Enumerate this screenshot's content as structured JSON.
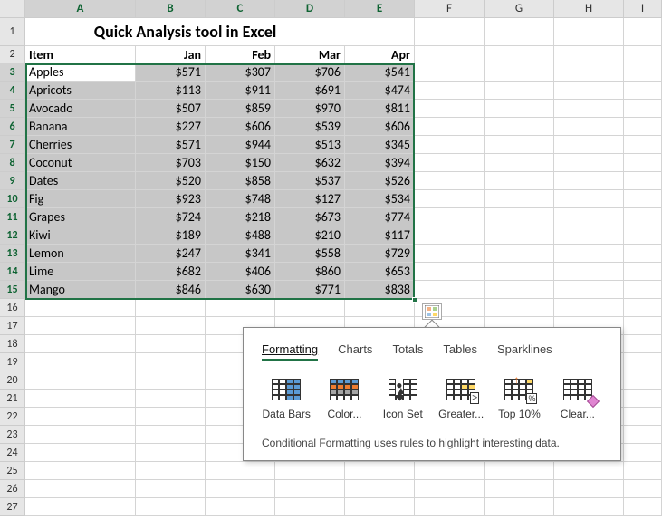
{
  "columns": [
    "A",
    "B",
    "C",
    "D",
    "E",
    "F",
    "G",
    "H",
    "I"
  ],
  "title": "Quick Analysis tool in Excel",
  "headers": [
    "Item",
    "Jan",
    "Feb",
    "Mar",
    "Apr"
  ],
  "rows": [
    {
      "item": "Apples",
      "vals": [
        "$571",
        "$307",
        "$706",
        "$541"
      ]
    },
    {
      "item": "Apricots",
      "vals": [
        "$113",
        "$911",
        "$691",
        "$474"
      ]
    },
    {
      "item": "Avocado",
      "vals": [
        "$507",
        "$859",
        "$970",
        "$811"
      ]
    },
    {
      "item": "Banana",
      "vals": [
        "$227",
        "$606",
        "$539",
        "$606"
      ]
    },
    {
      "item": "Cherries",
      "vals": [
        "$571",
        "$944",
        "$513",
        "$345"
      ]
    },
    {
      "item": "Coconut",
      "vals": [
        "$703",
        "$150",
        "$632",
        "$394"
      ]
    },
    {
      "item": "Dates",
      "vals": [
        "$520",
        "$858",
        "$537",
        "$526"
      ]
    },
    {
      "item": "Fig",
      "vals": [
        "$923",
        "$748",
        "$127",
        "$534"
      ]
    },
    {
      "item": "Grapes",
      "vals": [
        "$724",
        "$218",
        "$673",
        "$774"
      ]
    },
    {
      "item": "Kiwi",
      "vals": [
        "$189",
        "$488",
        "$210",
        "$117"
      ]
    },
    {
      "item": "Lemon",
      "vals": [
        "$247",
        "$341",
        "$558",
        "$729"
      ]
    },
    {
      "item": "Lime",
      "vals": [
        "$682",
        "$406",
        "$860",
        "$653"
      ]
    },
    {
      "item": "Mango",
      "vals": [
        "$846",
        "$630",
        "$771",
        "$838"
      ]
    }
  ],
  "row_numbers_visible": 27,
  "qa": {
    "tabs": [
      "Formatting",
      "Charts",
      "Totals",
      "Tables",
      "Sparklines"
    ],
    "active_tab": "Formatting",
    "options": [
      {
        "label": "Data Bars",
        "icon": "databars"
      },
      {
        "label": "Color...",
        "icon": "colorscale"
      },
      {
        "label": "Icon Set",
        "icon": "iconset"
      },
      {
        "label": "Greater...",
        "icon": "greater"
      },
      {
        "label": "Top 10%",
        "icon": "top10"
      },
      {
        "label": "Clear...",
        "icon": "clear"
      }
    ],
    "description": "Conditional Formatting uses rules to highlight interesting data."
  }
}
